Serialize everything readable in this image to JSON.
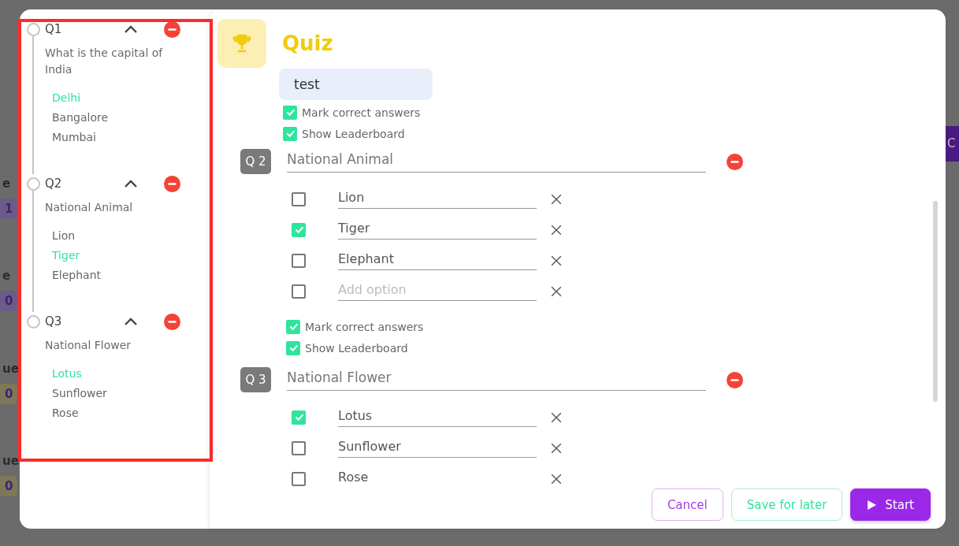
{
  "background": {
    "rows": [
      {
        "label": "e",
        "count": "1",
        "color": "#6a5c86"
      },
      {
        "label": "e",
        "count": "0",
        "color": "#6a5c86"
      },
      {
        "label": "ue",
        "count": "0",
        "color": "#7c7858"
      },
      {
        "label": "ue",
        "count": "0",
        "color": "#7c7858"
      }
    ],
    "side_button": "C"
  },
  "sidebar": {
    "questions": [
      {
        "label": "Q1",
        "text": "What is the capital of India",
        "expanded": true,
        "options": [
          {
            "text": "Delhi",
            "correct": true
          },
          {
            "text": "Bangalore",
            "correct": false
          },
          {
            "text": "Mumbai",
            "correct": false
          }
        ]
      },
      {
        "label": "Q2",
        "text": "National Animal",
        "expanded": true,
        "options": [
          {
            "text": "Lion",
            "correct": false
          },
          {
            "text": "Tiger",
            "correct": true
          },
          {
            "text": "Elephant",
            "correct": false
          }
        ]
      },
      {
        "label": "Q3",
        "text": "National Flower",
        "expanded": true,
        "options": [
          {
            "text": "Lotus",
            "correct": true
          },
          {
            "text": "Sunflower",
            "correct": false
          },
          {
            "text": "Rose",
            "correct": false
          }
        ]
      }
    ],
    "highlighted": true
  },
  "header": {
    "title": "Quiz"
  },
  "name_field": {
    "value": "test"
  },
  "settings": [
    {
      "label": "Mark correct answers",
      "checked": true
    },
    {
      "label": "Show Leaderboard",
      "checked": true
    }
  ],
  "questions": [
    {
      "number": "Q 2",
      "title": "National Animal",
      "options": [
        {
          "value": "Lion",
          "checked": false
        },
        {
          "value": "Tiger",
          "checked": true
        },
        {
          "value": "Elephant",
          "checked": false
        },
        {
          "placeholder": "Add option",
          "checked": false
        }
      ],
      "settings": [
        {
          "label": "Mark correct answers",
          "checked": true
        },
        {
          "label": "Show Leaderboard",
          "checked": true
        }
      ]
    },
    {
      "number": "Q 3",
      "title": "National Flower",
      "options": [
        {
          "value": "Lotus",
          "checked": true
        },
        {
          "value": "Sunflower",
          "checked": false
        },
        {
          "value": "Rose",
          "checked": false
        }
      ]
    }
  ],
  "buttons": [
    {
      "label": "Cancel",
      "kind": "outline-purple"
    },
    {
      "label": "Save for later",
      "kind": "outline-green"
    },
    {
      "label": "Start",
      "kind": "primary"
    }
  ]
}
